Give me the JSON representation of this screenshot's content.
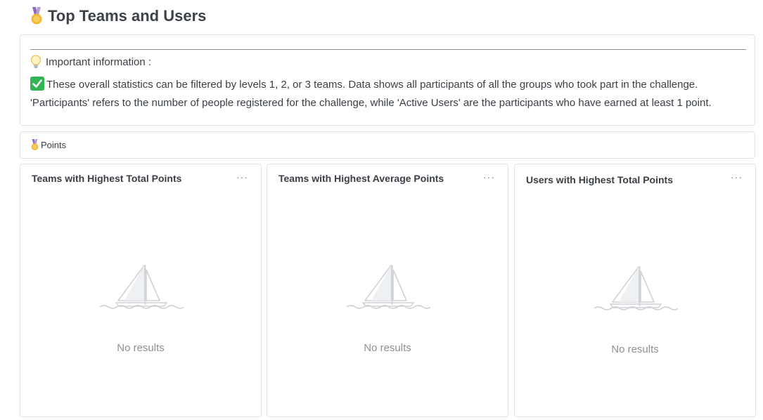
{
  "page": {
    "title": "Top Teams and Users"
  },
  "info": {
    "heading": "Important information :",
    "line1": "These overall statistics can be filtered by levels 1, 2, or 3 teams. Data shows all participants of all the groups who took part in the challenge.",
    "line2": "'Participants' refers to the number of people registered for the challenge, while 'Active Users' are the participants who have earned at least 1 point."
  },
  "section": {
    "label": "Points"
  },
  "panels": [
    {
      "title": "Teams with Highest Total Points",
      "menu": "···",
      "empty_text": "No results"
    },
    {
      "title": "Teams with Highest Average Points",
      "menu": "···",
      "empty_text": "No results"
    },
    {
      "title": "Users with Highest Total Points",
      "menu": "···",
      "empty_text": "No results"
    }
  ],
  "icons": {
    "title": "medal-icon",
    "info": "lightbulb-icon",
    "check": "check-mark-icon",
    "section": "medal-icon",
    "empty": "sailboat-icon"
  },
  "colors": {
    "check_green": "#31b452",
    "medal_gold": "#f2b632",
    "ribbon_purple": "#8d6bb8",
    "border": "#e1e3e6",
    "muted_text": "#8c9096"
  }
}
